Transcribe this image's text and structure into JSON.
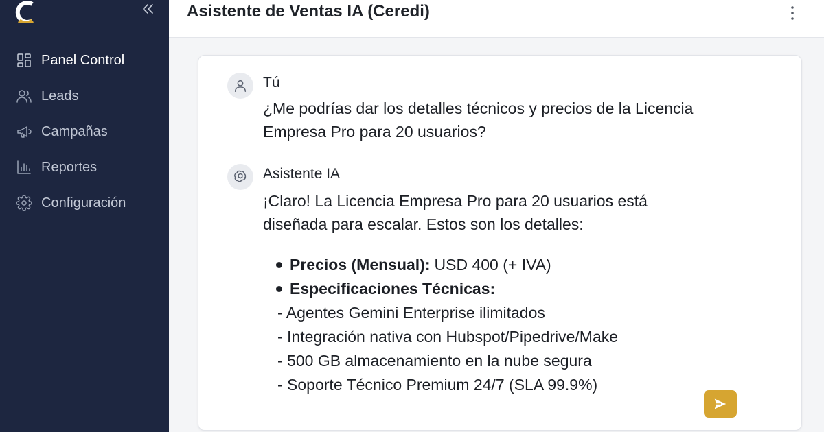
{
  "app": {
    "title": "Asistente de Ventas IA (Ceredi)",
    "colors": {
      "sidebar_bg": "#1d2640",
      "accent": "#d6a531",
      "page_bg": "#f4f5f7"
    }
  },
  "sidebar": {
    "items": [
      {
        "label": "Panel Control",
        "icon": "dashboard-icon",
        "active": true
      },
      {
        "label": "Leads",
        "icon": "users-icon",
        "active": false
      },
      {
        "label": "Campañas",
        "icon": "megaphone-icon",
        "active": false
      },
      {
        "label": "Reportes",
        "icon": "bar-chart-icon",
        "active": false
      },
      {
        "label": "Configuración",
        "icon": "gear-icon",
        "active": false
      }
    ]
  },
  "chat": {
    "user": {
      "name": "Tú",
      "message_line1": "¿Me podrías dar los detalles técnicos y precios de la Licencia",
      "message_line2": "Empresa Pro para 20 usuarios?"
    },
    "assistant": {
      "name": "Asistente IA",
      "intro_line1": "¡Claro! La Licencia Empresa Pro para 20 usuarios está",
      "intro_line2": "diseñada para escalar. Estos son los detalles:",
      "price_label": "Precios (Mensual):",
      "price_value": "USD 400 (+ IVA)",
      "specs_label": "Especificaciones Técnicas:",
      "specs": [
        "- Agentes Gemini Enterprise ilimitados",
        "- Integración nativa con Hubspot/Pipedrive/Make",
        "- 500 GB almacenamiento en la nube segura",
        "- Soporte Técnico Premium 24/7 (SLA 99.9%)"
      ]
    }
  }
}
